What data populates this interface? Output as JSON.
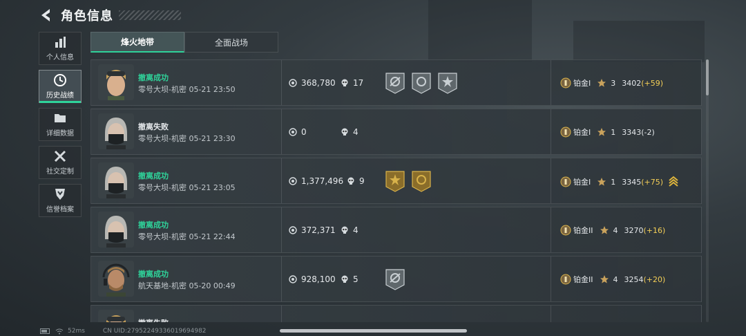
{
  "header": {
    "title": "角色信息",
    "back_icon": "back-arrow-icon"
  },
  "sidebar": {
    "items": [
      {
        "label": "个人信息",
        "icon": "bar-chart-icon",
        "active": false
      },
      {
        "label": "历史战绩",
        "icon": "clock-history-icon",
        "active": true
      },
      {
        "label": "详细数据",
        "icon": "folder-icon",
        "active": false
      },
      {
        "label": "社交定制",
        "icon": "tools-icon",
        "active": false
      },
      {
        "label": "信誉档案",
        "icon": "shield-badge-icon",
        "active": false
      }
    ]
  },
  "tabs": [
    {
      "label": "烽火地带",
      "active": true
    },
    {
      "label": "全面战场",
      "active": false
    }
  ],
  "matches": [
    {
      "avatar": "blonde-goggles-avatar",
      "result": "撤离成功",
      "success": true,
      "map": "零号大坝-机密 05-21 23:50",
      "value": "368,780",
      "kills": "17",
      "medals": [
        "gray-rifle-medal",
        "gray-crosshair-medal",
        "gray-burst-medal"
      ],
      "rank": "铂金I",
      "rank_stars": "3",
      "score": "3402",
      "delta": "(+59)",
      "delta_up": true,
      "promo": false
    },
    {
      "avatar": "masked-gray-hair-avatar",
      "result": "撤离失败",
      "success": false,
      "map": "零号大坝-机密 05-21 23:30",
      "value": "0",
      "kills": "4",
      "medals": [],
      "rank": "铂金I",
      "rank_stars": "1",
      "score": "3343",
      "delta": "(-2)",
      "delta_up": false,
      "promo": false
    },
    {
      "avatar": "masked-gray-hair-avatar",
      "result": "撤离成功",
      "success": true,
      "map": "零号大坝-机密 05-21 23:05",
      "value": "1,377,496",
      "kills": "9",
      "medals": [
        "gold-star-medal",
        "gold-target-medal"
      ],
      "rank": "铂金I",
      "rank_stars": "1",
      "score": "3345",
      "delta": "(+75)",
      "delta_up": true,
      "promo": true
    },
    {
      "avatar": "masked-gray-hair-avatar",
      "result": "撤离成功",
      "success": true,
      "map": "零号大坝-机密 05-21 22:44",
      "value": "372,371",
      "kills": "4",
      "medals": [],
      "rank": "铂金II",
      "rank_stars": "4",
      "score": "3270",
      "delta": "(+16)",
      "delta_up": true,
      "promo": false
    },
    {
      "avatar": "bearded-headset-avatar",
      "result": "撤离成功",
      "success": true,
      "map": "航天基地-机密 05-20 00:49",
      "value": "928,100",
      "kills": "5",
      "medals": [
        "gray-rifle-medal"
      ],
      "rank": "铂金II",
      "rank_stars": "4",
      "score": "3254",
      "delta": "(+20)",
      "delta_up": true,
      "promo": false
    },
    {
      "avatar": "blonde-goggles-avatar",
      "result": "撤离失败",
      "success": false,
      "map": "",
      "value": "",
      "kills": "",
      "medals": [],
      "rank": "",
      "rank_stars": "",
      "score": "",
      "delta": "",
      "delta_up": false,
      "promo": false
    }
  ],
  "footer": {
    "ping": "52ms",
    "uid": "CN UID:27952249336019694982"
  },
  "colors": {
    "success": "#2fd39a",
    "gain": "#f4cf57",
    "accent": "#2fd39a"
  }
}
